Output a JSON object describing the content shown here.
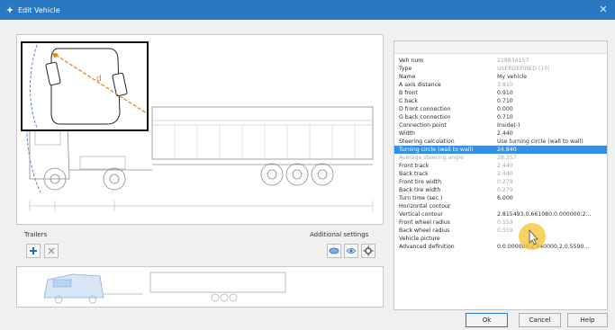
{
  "window": {
    "title": "Edit Vehicle",
    "close_glyph": "✕"
  },
  "colors": {
    "titlebar": "#2b78c2",
    "selection": "#3390e4",
    "cursor_highlight": "#f6c42f",
    "turning_arrow": "#e8821e"
  },
  "properties": [
    {
      "key": "Veh num",
      "value": "228834157",
      "dim_value": true
    },
    {
      "key": "Type",
      "value": "USERDEFINED (10)",
      "dim_value": true
    },
    {
      "key": "Name",
      "value": "My vehicle"
    },
    {
      "key": "A axis distance",
      "value": "3.810",
      "dim_value": true
    },
    {
      "key": "B front",
      "value": "0.910"
    },
    {
      "key": "C back",
      "value": "0.710"
    },
    {
      "key": "D front connection",
      "value": "0.000"
    },
    {
      "key": "G back connection",
      "value": "0.710"
    },
    {
      "key": "Connection point",
      "value": "Inside(-)"
    },
    {
      "key": "Width",
      "value": "2.440"
    },
    {
      "key": "Steering calculation",
      "value": "Use turning circle (wall to wall)"
    },
    {
      "key": "Turning circle (wall to wall)",
      "value": "24.840",
      "selected": true
    },
    {
      "key": "Average steering angle",
      "value": "28.357",
      "dim": true
    },
    {
      "key": "Front track",
      "value": "2.440",
      "dim_value": true
    },
    {
      "key": "Back track",
      "value": "2.440",
      "dim_value": true
    },
    {
      "key": "Front tire width",
      "value": "0.279",
      "dim_value": true
    },
    {
      "key": "Back tire width",
      "value": "0.279",
      "dim_value": true
    },
    {
      "key": "Turn time (sec.)",
      "value": "6.000"
    },
    {
      "key": "Horizontal contour",
      "value": ""
    },
    {
      "key": "Vertical contour",
      "value": "2.815493,0.661080,0.000000;2..."
    },
    {
      "key": "Front wheel radius",
      "value": "0.559",
      "dim_value": true
    },
    {
      "key": "Back wheel radius",
      "value": "0.559",
      "dim_value": true
    },
    {
      "key": "Vehicle picture",
      "value": ""
    },
    {
      "key": "Advanced definition",
      "value": "0,0.000000,2.440000,2,0.5590..."
    }
  ],
  "trailers": {
    "label": "Trailers",
    "add_icon": "plus-icon",
    "remove_icon": "x-icon"
  },
  "additional_settings": {
    "label": "Additional settings",
    "icons": [
      "wheel-icon",
      "eye-icon",
      "settings-icon"
    ]
  },
  "buttons": {
    "ok": "Ok",
    "cancel": "Cancel",
    "help": "Help"
  },
  "turning_label": "d"
}
